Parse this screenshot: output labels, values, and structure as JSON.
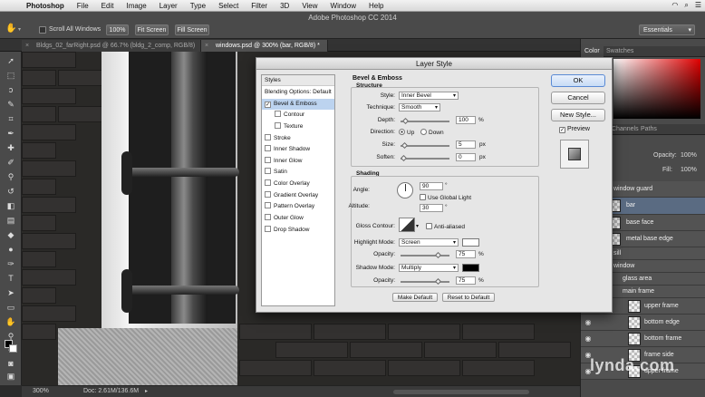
{
  "menubar": {
    "app": "Photoshop",
    "items": [
      "File",
      "Edit",
      "Image",
      "Layer",
      "Type",
      "Select",
      "Filter",
      "3D",
      "View",
      "Window",
      "Help"
    ]
  },
  "titlebar": {
    "title": "Adobe Photoshop CC 2014"
  },
  "options": {
    "scroll_all": "Scroll All Windows",
    "zoom": "100%",
    "fit_screen": "Fit Screen",
    "fill_screen": "Fill Screen",
    "workspace": "Essentials"
  },
  "tabs": [
    {
      "label": "Bldgs_02_farRight.psd @ 66.7% (bldg_2_comp, RGB/8)"
    },
    {
      "label": "windows.psd @ 300% (bar, RGB/8) *"
    }
  ],
  "status": {
    "zoom": "300%",
    "doc": "Doc: 2.61M/136.6M"
  },
  "panels": {
    "color_tab": "Color",
    "swatches_tab": "Swatches",
    "channels_tab": "Channels",
    "paths_tab": "Paths",
    "opacity_label": "Opacity:",
    "opacity_value": "100%",
    "fill_label": "Fill:",
    "fill_value": "100%"
  },
  "layers": [
    {
      "name": "window guard",
      "type": "group"
    },
    {
      "name": "bar",
      "type": "layer",
      "selected": true
    },
    {
      "name": "base face",
      "type": "layer"
    },
    {
      "name": "metal base edge",
      "type": "layer"
    },
    {
      "name": "sill",
      "type": "group"
    },
    {
      "name": "window",
      "type": "group"
    },
    {
      "name": "glass area",
      "type": "group"
    },
    {
      "name": "main frame",
      "type": "group"
    },
    {
      "name": "upper frame",
      "type": "layer"
    },
    {
      "name": "bottom edge",
      "type": "layer"
    },
    {
      "name": "bottom frame",
      "type": "layer"
    },
    {
      "name": "frame side",
      "type": "layer"
    },
    {
      "name": "upper frame",
      "type": "layer"
    }
  ],
  "watermark": "lynda.com",
  "dialog": {
    "title": "Layer Style",
    "styles_header": "Styles",
    "blending_options": "Blending Options: Default",
    "style_items": [
      {
        "label": "Bevel & Emboss",
        "checked": true,
        "selected": true,
        "sub": false
      },
      {
        "label": "Contour",
        "checked": false,
        "sub": true
      },
      {
        "label": "Texture",
        "checked": false,
        "sub": true
      },
      {
        "label": "Stroke",
        "checked": false,
        "sub": false
      },
      {
        "label": "Inner Shadow",
        "checked": false,
        "sub": false
      },
      {
        "label": "Inner Glow",
        "checked": false,
        "sub": false
      },
      {
        "label": "Satin",
        "checked": false,
        "sub": false
      },
      {
        "label": "Color Overlay",
        "checked": false,
        "sub": false
      },
      {
        "label": "Gradient Overlay",
        "checked": false,
        "sub": false
      },
      {
        "label": "Pattern Overlay",
        "checked": false,
        "sub": false
      },
      {
        "label": "Outer Glow",
        "checked": false,
        "sub": false
      },
      {
        "label": "Drop Shadow",
        "checked": false,
        "sub": false
      }
    ],
    "bevel": {
      "section_title": "Bevel & Emboss",
      "structure_title": "Structure",
      "style_label": "Style:",
      "style_value": "Inner Bevel",
      "technique_label": "Technique:",
      "technique_value": "Smooth",
      "depth_label": "Depth:",
      "depth_value": "100",
      "depth_unit": "%",
      "direction_label": "Direction:",
      "direction_up": "Up",
      "direction_down": "Down",
      "size_label": "Size:",
      "size_value": "5",
      "size_unit": "px",
      "soften_label": "Soften:",
      "soften_value": "0",
      "soften_unit": "px"
    },
    "shading": {
      "title": "Shading",
      "angle_label": "Angle:",
      "angle_value": "90",
      "global_light": "Use Global Light",
      "altitude_label": "Altitude:",
      "altitude_value": "30",
      "gloss_label": "Gloss Contour:",
      "anti_aliased": "Anti-aliased",
      "highlight_label": "Highlight Mode:",
      "highlight_value": "Screen",
      "highlight_color": "#ffffff",
      "h_opacity_label": "Opacity:",
      "h_opacity_value": "75",
      "shadow_label": "Shadow Mode:",
      "shadow_value": "Multiply",
      "shadow_color": "#000000",
      "s_opacity_label": "Opacity:",
      "s_opacity_value": "75",
      "pct": "%",
      "degree": "°"
    },
    "make_default": "Make Default",
    "reset_default": "Reset to Default",
    "ok": "OK",
    "cancel": "Cancel",
    "new_style": "New Style...",
    "preview": "Preview"
  }
}
